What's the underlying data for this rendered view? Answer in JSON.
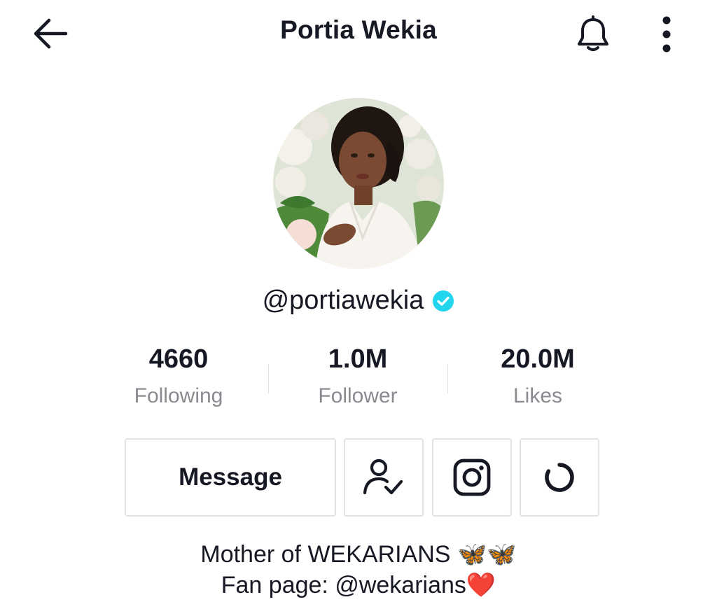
{
  "header": {
    "title": "Portia Wekia"
  },
  "profile": {
    "username": "@portiawekia",
    "verified": true
  },
  "stats": [
    {
      "value": "4660",
      "label": "Following"
    },
    {
      "value": "1.0M",
      "label": "Follower"
    },
    {
      "value": "20.0M",
      "label": "Likes"
    }
  ],
  "actions": {
    "message_label": "Message"
  },
  "bio": {
    "line1": "Mother of WEKARIANS",
    "line1_emoji": "🦋🦋",
    "line2": "Fan page: @wekarians",
    "line2_emoji": "❤️"
  },
  "colors": {
    "verified": "#20d5ec",
    "muted_text": "#8a8b91",
    "border": "#e3e3e4",
    "heart": "#fe2c55"
  }
}
